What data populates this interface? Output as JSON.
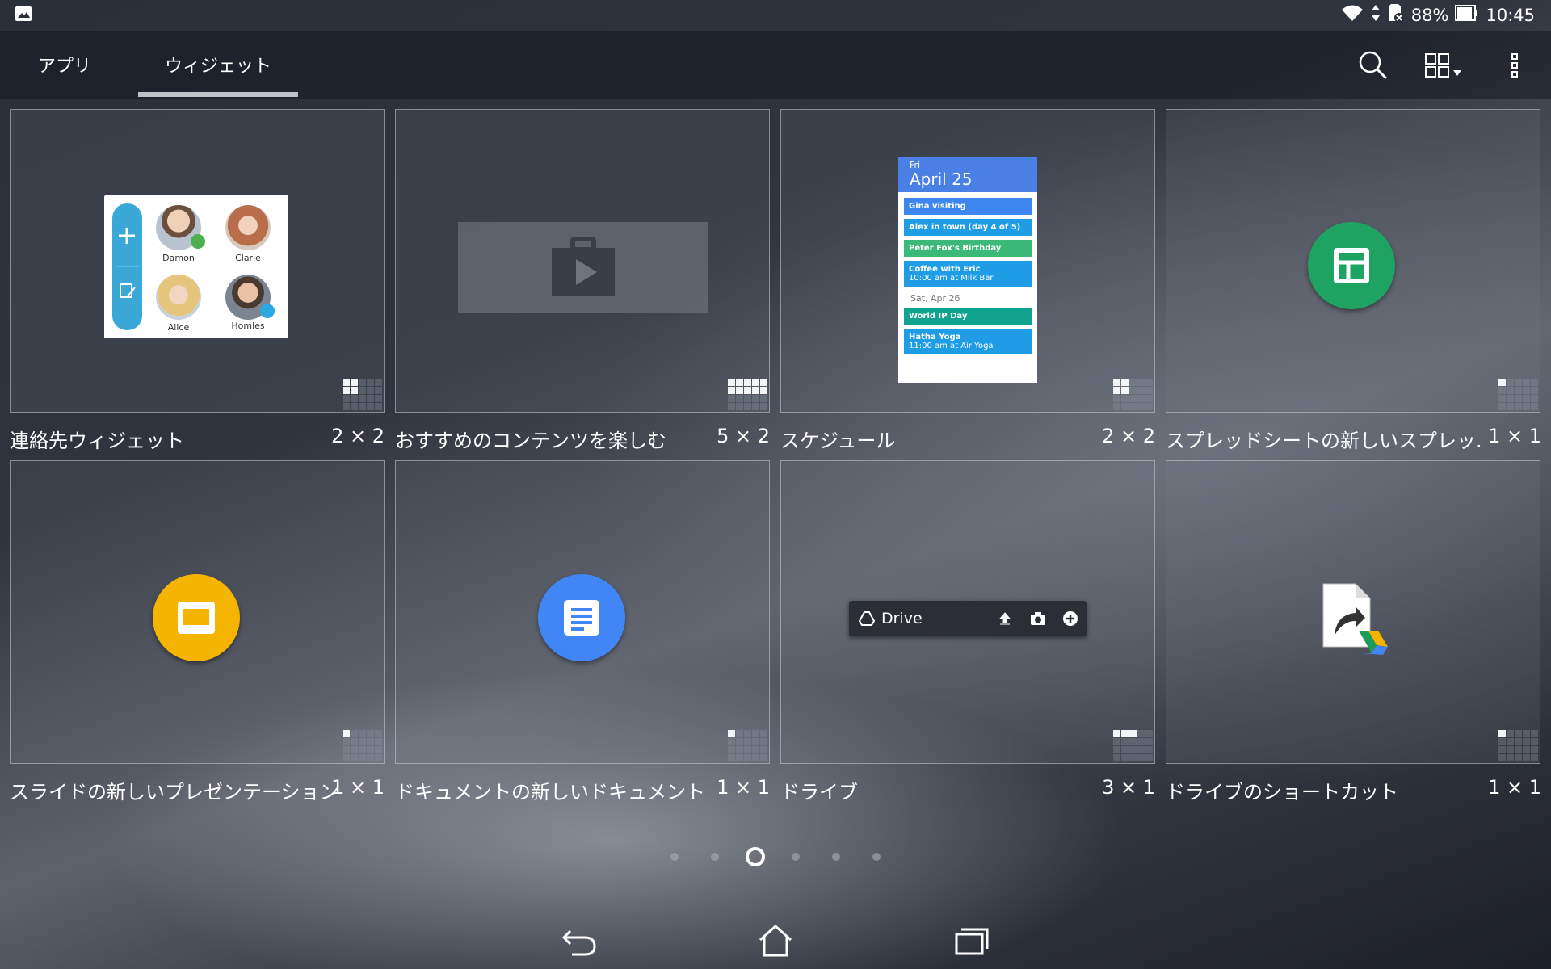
{
  "status_bar": {
    "battery_text": "88%",
    "time": "10:45",
    "icons": [
      "image-icon",
      "wifi-icon",
      "data-arrows-icon",
      "sd-card-icon",
      "battery-icon"
    ]
  },
  "tabs": [
    {
      "label": "アプリ",
      "selected": false
    },
    {
      "label": "ウィジェット",
      "selected": true
    }
  ],
  "toolbar_icons": [
    "search-icon",
    "grid-view-icon",
    "more-vert-icon"
  ],
  "widgets": [
    {
      "label": "連絡先ウィジェット",
      "size": "2 × 2",
      "filled_cells": 4
    },
    {
      "label": "おすすめのコンテンツを楽しむ",
      "size": "5 × 2",
      "filled_cells": 10
    },
    {
      "label": "スケジュール",
      "size": "2 × 2",
      "filled_cells": 4
    },
    {
      "label": "スプレッドシートの新しいスプレッ..",
      "size": "1 × 1",
      "filled_cells": 1
    },
    {
      "label": "スライドの新しいプレゼンテーション",
      "size": "1 × 1",
      "filled_cells": 1
    },
    {
      "label": "ドキュメントの新しいドキュメント",
      "size": "1 × 1",
      "filled_cells": 1
    },
    {
      "label": "ドライブ",
      "size": "3 × 1",
      "filled_cells": 3
    },
    {
      "label": "ドライブのショートカット",
      "size": "1 × 1",
      "filled_cells": 1
    }
  ],
  "contacts_preview": {
    "names": [
      "Damon",
      "Clarie",
      "Alice",
      "Homles"
    ]
  },
  "calendar_preview": {
    "day": "Fri",
    "date": "April 25",
    "events": [
      {
        "title": "Gina visiting",
        "color": "#3d86f0"
      },
      {
        "title": "Alex in town (day 4 of 5)",
        "color": "#1e9ce6"
      },
      {
        "title": "Peter Fox's Birthday",
        "color": "#3cb878"
      },
      {
        "title": "Coffee with Eric",
        "subtitle": "10:00 am at Milk Bar",
        "color": "#1e9ce6"
      },
      {
        "title": "World IP Day",
        "color": "#12a38f"
      },
      {
        "title": "Hatha Yoga",
        "subtitle": "11:00 am at Air Yoga",
        "color": "#1e9ce6"
      }
    ],
    "separator": "Sat, Apr 26"
  },
  "drive_preview": {
    "label": "Drive"
  },
  "page_indicator": {
    "count": 6,
    "active_index": 2
  },
  "nav_buttons": [
    "back-icon",
    "home-icon",
    "recents-icon"
  ],
  "colors": {
    "sheets_green": "#1ea362",
    "slides_yellow": "#f4b400",
    "docs_blue": "#4285f4",
    "contacts_blue": "#3aa9d8"
  }
}
